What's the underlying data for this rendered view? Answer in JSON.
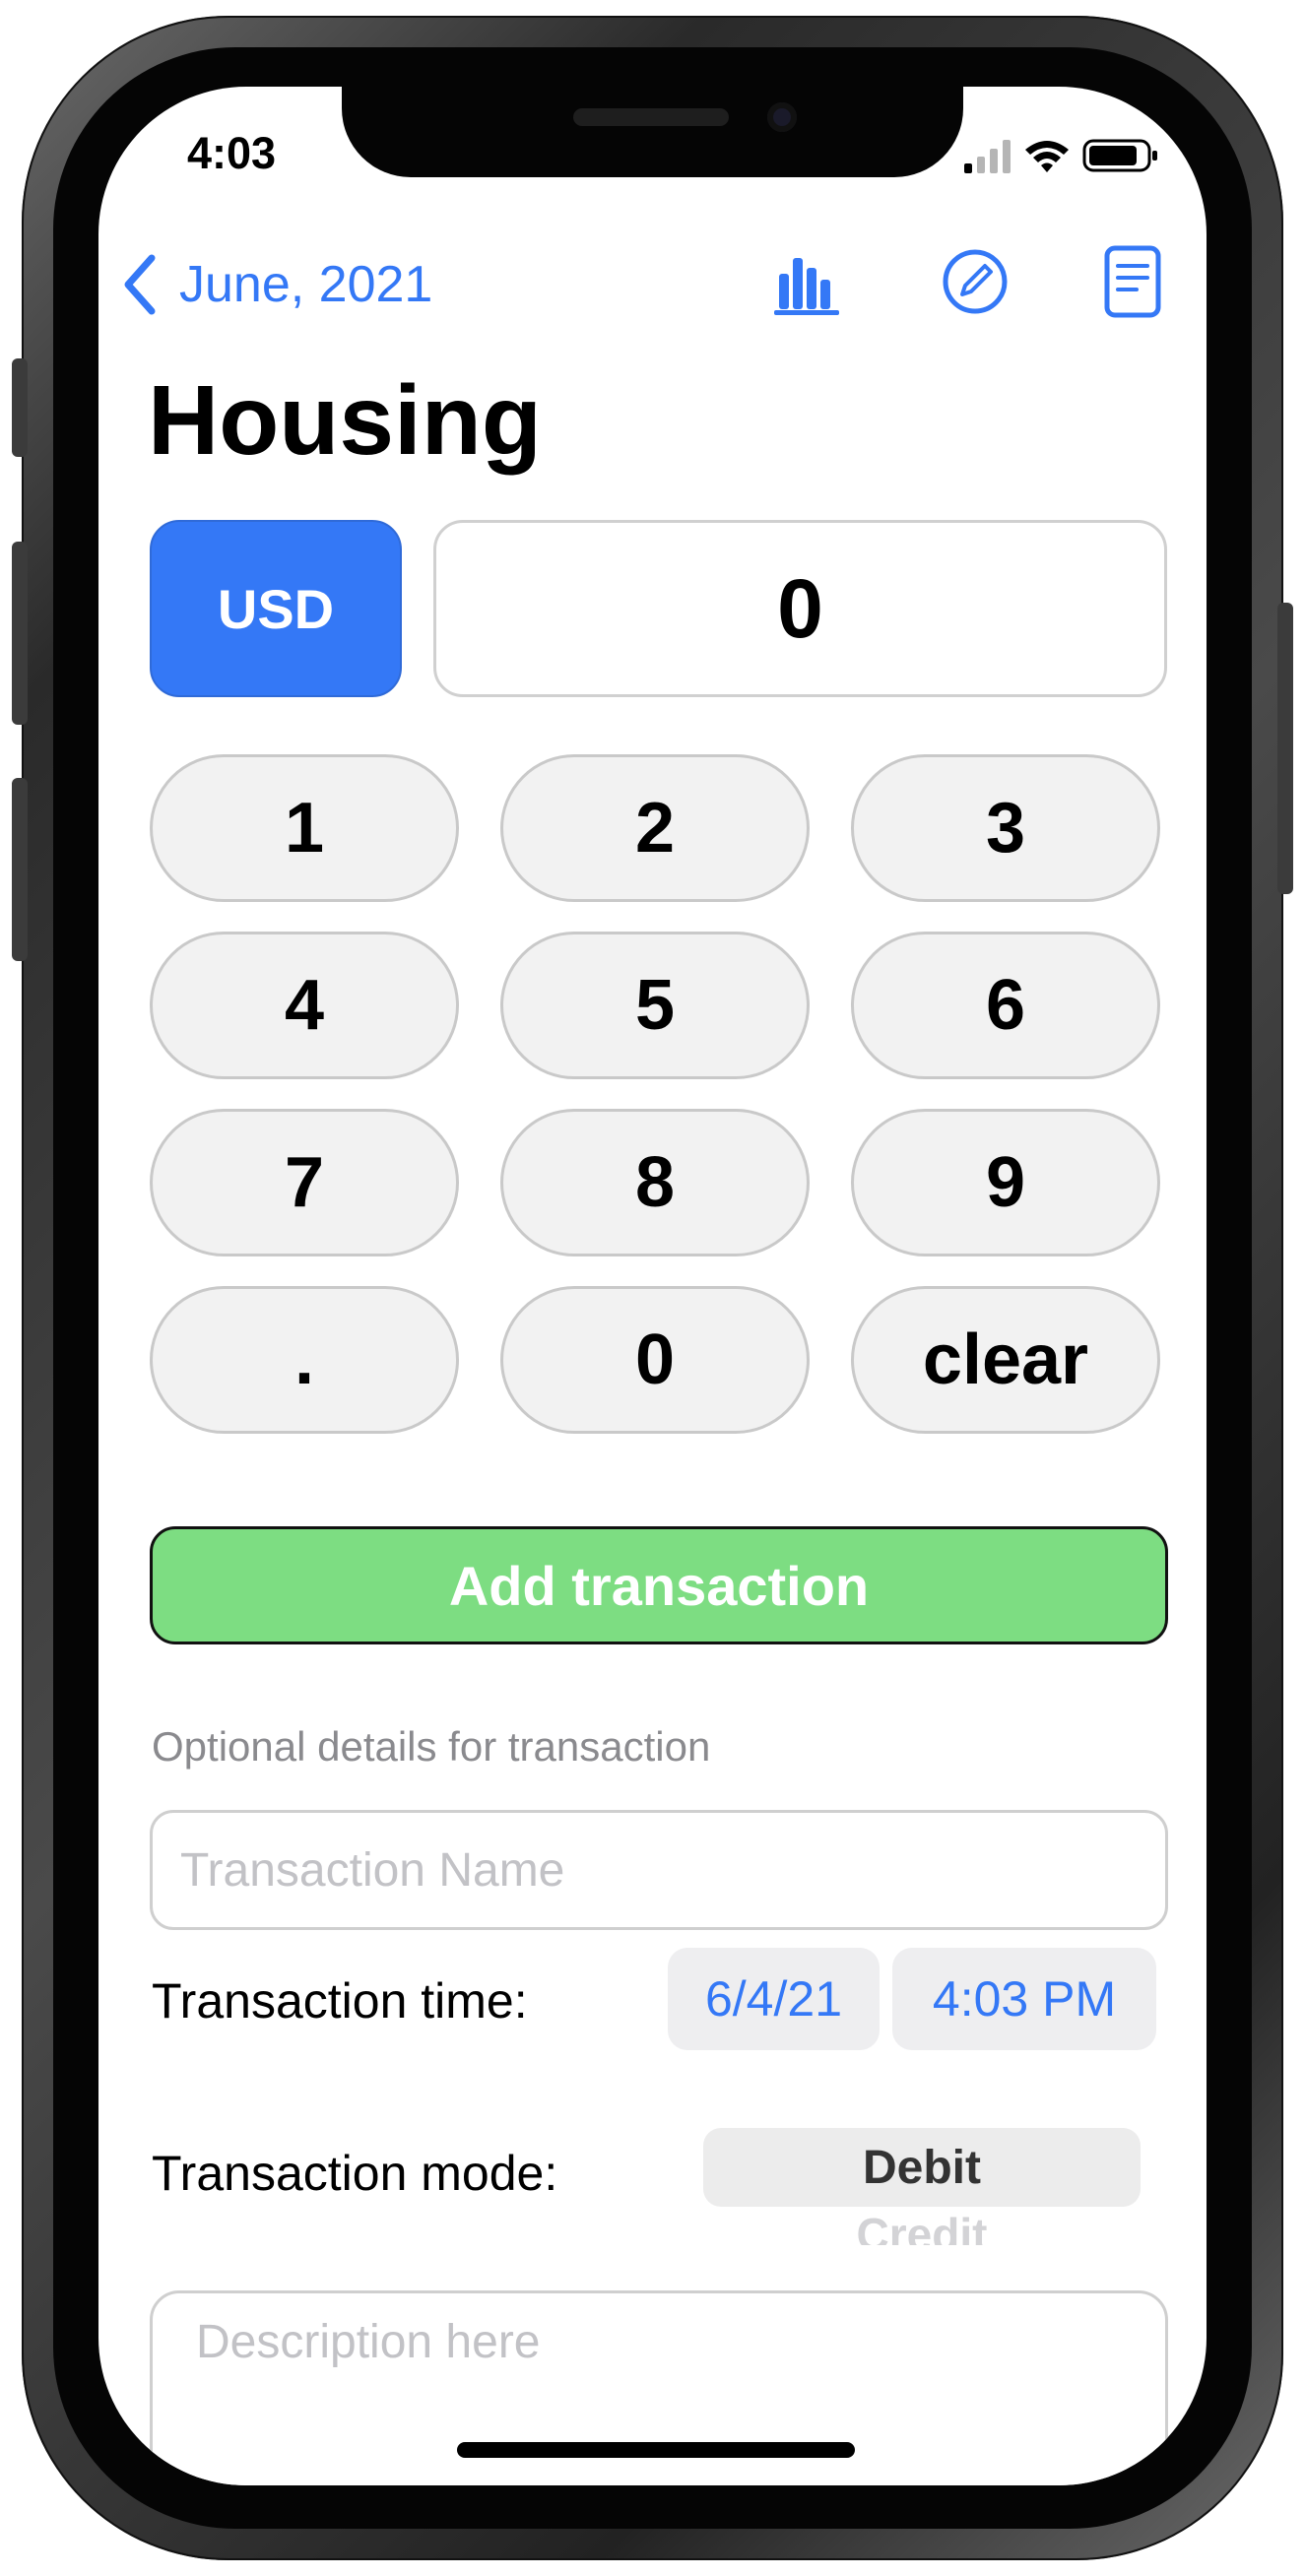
{
  "status_bar": {
    "time": "4:03"
  },
  "nav": {
    "back_label": "June, 2021"
  },
  "title": "Housing",
  "currency": {
    "label": "USD",
    "color": "#3478f6"
  },
  "amount": "0",
  "keypad": [
    "1",
    "2",
    "3",
    "4",
    "5",
    "6",
    "7",
    "8",
    "9",
    ".",
    "0",
    "clear"
  ],
  "add_button": {
    "label": "Add transaction",
    "color": "#7ddd82"
  },
  "details": {
    "section_label": "Optional details for transaction",
    "name_placeholder": "Transaction Name",
    "time_label": "Transaction time:",
    "date_value": "6/4/21",
    "time_value": "4:03 PM",
    "mode_label": "Transaction mode:",
    "mode_selected": "Debit",
    "mode_next": "Credit",
    "description_placeholder": "Description here"
  },
  "icons": {
    "back": "chevron-left-icon",
    "stats": "bar-chart-icon",
    "edit": "pencil-circle-icon",
    "notes": "document-icon"
  }
}
